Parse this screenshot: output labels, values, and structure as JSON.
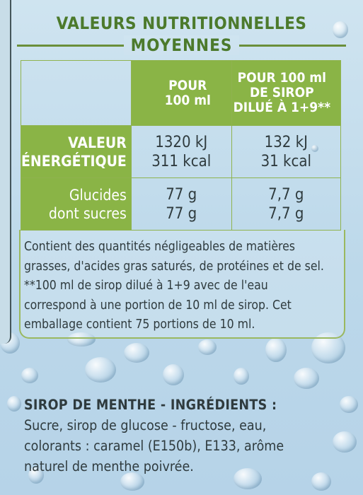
{
  "title": "VALEURS NUTRITIONNELLES",
  "subtitle": "MOYENNES",
  "table": {
    "col1_header": [
      "POUR",
      "100 ml"
    ],
    "col2_header": [
      "POUR 100 ml",
      "DE SIROP",
      "DILUÉ À 1+9**"
    ],
    "energy_label": [
      "VALEUR",
      "ÉNERGÉTIQUE"
    ],
    "energy_col1": [
      "1320 kJ",
      "311 kcal"
    ],
    "energy_col2": [
      "132 kJ",
      "31 kcal"
    ],
    "sugar_label": [
      "Glucides",
      "dont sucres"
    ],
    "sugar_col1": [
      "77 g",
      "77 g"
    ],
    "sugar_col2": [
      "7,7 g",
      "7,7 g"
    ]
  },
  "notes": [
    "Contient des quantités négligeables de matières",
    "grasses, d'acides gras saturés, de protéines et de sel.",
    "**100 ml de sirop dilué à 1+9 avec de l'eau",
    "correspond à une portion de 10 ml de sirop. Cet",
    "emballage contient 75 portions de 10 ml."
  ],
  "ingredients": {
    "heading": "SIROP DE MENTHE - INGRÉDIENTS :",
    "lines": [
      "Sucre, sirop de glucose - fructose, eau,",
      "colorants : caramel (E150b), E133, arôme",
      "naturel de menthe poivrée."
    ]
  },
  "colors": {
    "green": "#8ab446",
    "dark_green": "#4c7a2c",
    "text": "#2f3b3e",
    "background": "#c6deec"
  }
}
